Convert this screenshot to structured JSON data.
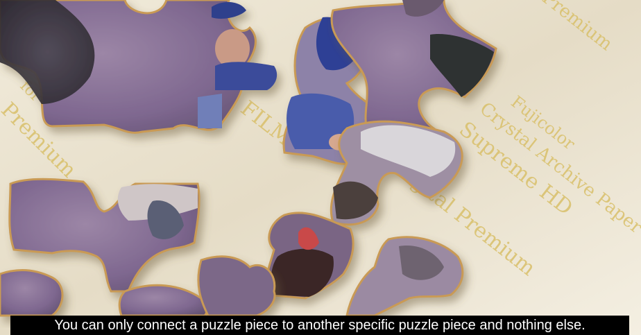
{
  "image": {
    "description_icon": "puzzle-photo"
  },
  "paper_print": {
    "line1": "Fujicolor",
    "line2": "Crystal Archive Paper",
    "line3": "Supreme HD",
    "line4": "Digital Premium",
    "line5": "FILM",
    "line6": "Premium",
    "line7": "for",
    "line8": "Premium"
  },
  "caption": {
    "text": "You can only connect a puzzle piece to another specific puzzle piece and nothing else."
  },
  "colors": {
    "paper": "#ece5d1",
    "paper_ink": "#d9c06a",
    "piece_purple": "#8b7398",
    "piece_edge": "#c99a55",
    "caption_bg": "#000000",
    "caption_fg": "#ffffff"
  }
}
